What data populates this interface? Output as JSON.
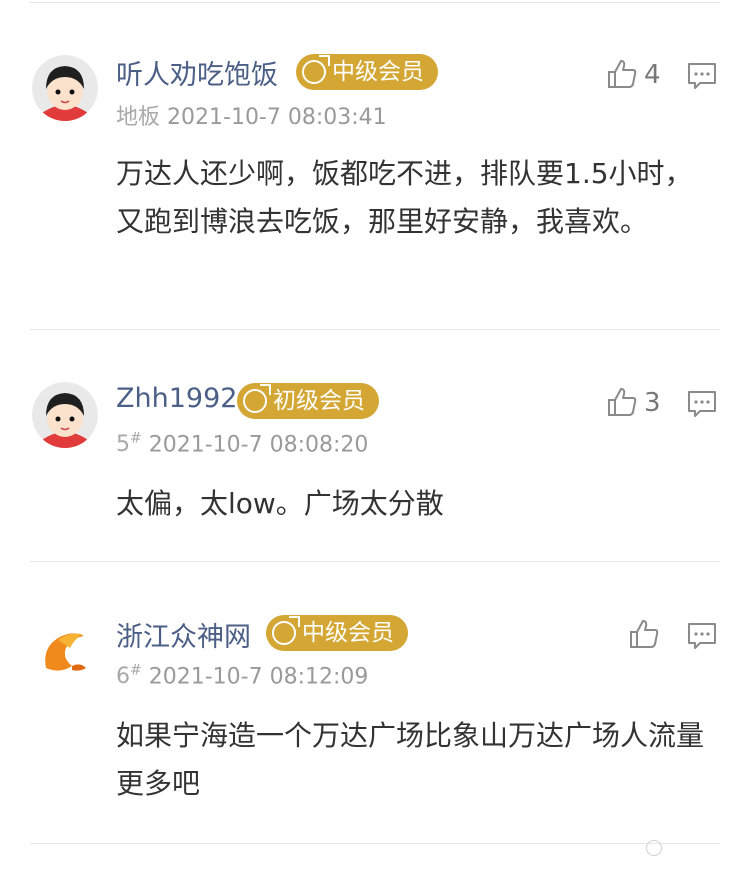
{
  "comments": [
    {
      "username": "听人劝吃饱饭",
      "badge": "中级会员",
      "floor": "地板",
      "time": "2021-10-7 08:03:41",
      "content": "万达人还少啊，饭都吃不进，排队要1.5小时，又跑到博浪去吃饭，那里好安静，我喜欢。",
      "likes": "4"
    },
    {
      "username": "Zhh1992",
      "badge": "初级会员",
      "floor_num": "5",
      "floor_mark": "#",
      "time": "2021-10-7 08:08:20",
      "content": "太偏，太low。广场太分散",
      "likes": "3"
    },
    {
      "username": "浙江众神网",
      "badge": "中级会员",
      "floor_num": "6",
      "floor_mark": "#",
      "time": "2021-10-7 08:12:09",
      "content": "如果宁海造一个万达广场比象山万达广场人流量更多吧",
      "likes": ""
    }
  ],
  "icons": {
    "like": "thumbs-up-icon",
    "comment": "comment-bubble-icon",
    "badge": "male-symbol-icon"
  },
  "colors": {
    "username": "#4c5f86",
    "badge": "#d4a633",
    "meta": "#9a9a9a",
    "content": "#333333"
  }
}
